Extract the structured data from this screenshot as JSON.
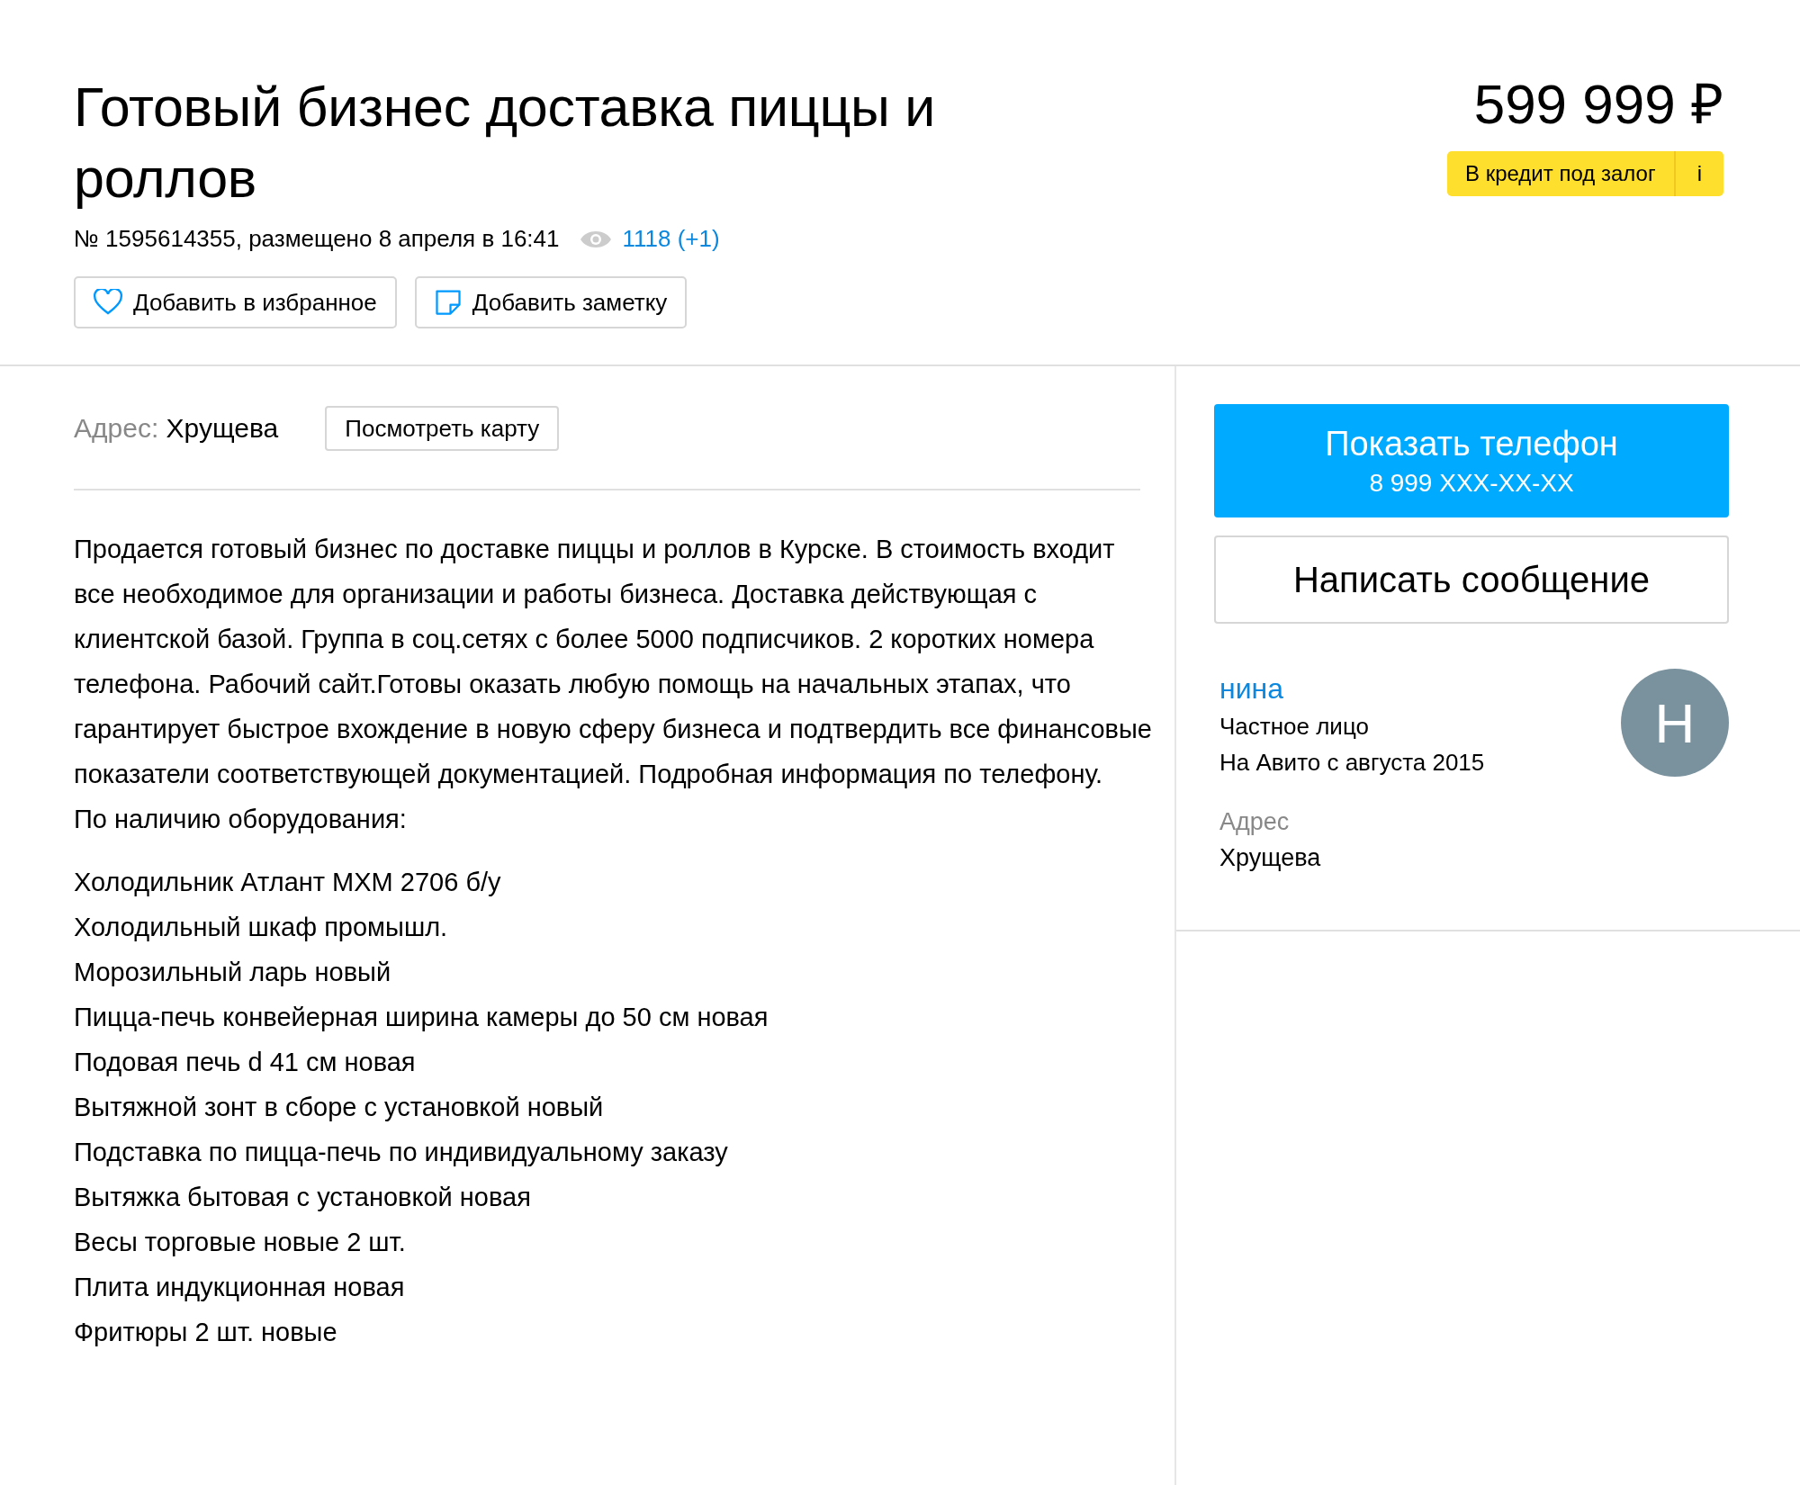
{
  "listing": {
    "title": "Готовый бизнес доставка пиццы и роллов",
    "number_and_date": "№ 1595614355, размещено 8 апреля в 16:41",
    "views": "1118 (+1)",
    "actions": [
      {
        "kind": "favorite",
        "label": "Добавить в избранное"
      },
      {
        "kind": "note",
        "label": "Добавить заметку"
      }
    ]
  },
  "price": {
    "value": "599 999 ₽",
    "credit_badge": "В кредит под залог",
    "info_button": "i"
  },
  "address": {
    "label": "Адрес:",
    "value": "Хрущева",
    "map_button": "Посмотреть карту"
  },
  "description": {
    "paragraphs": [
      "Продается готовый бизнес по доставке пиццы и роллов в Курске. В стоимость входит все необходимое для организации и работы бизнеса. Доставка действующая с клиентской базой. Группа в соц.сетях с более 5000 подписчиков. 2 коротких номера телефона. Рабочий сайт.Готовы оказать любую помощь на начальных этапах, что гарантирует быстрое вхождение в новую сферу бизнеса и подтвердить все финансовые показатели соответствующей документацией. Подробная информация по телефону.",
      "По наличию оборудования:"
    ],
    "equipment": [
      "Холодильник Атлант МХМ 2706 б/у",
      "Холодильный шкаф промышл.",
      "Морозильный ларь новый",
      "Пицца-печь конвейерная ширина камеры до 50 см новая",
      "Подовая печь d 41 см новая",
      "Вытяжной зонт в сборе с установкой новый",
      "Подставка по пицца-печь по индивидуальному заказу",
      "Вытяжка бытовая с установкой новая",
      "Весы торговые новые 2 шт.",
      "Плита индукционная новая",
      "Фритюры 2 шт. новые"
    ]
  },
  "sidebar": {
    "phone_button": {
      "label": "Показать телефон",
      "number": "8 999 XXX-XX-XX"
    },
    "message_button": "Написать сообщение",
    "seller": {
      "name": "нина",
      "type": "Частное лицо",
      "since": "На Авито с августа 2015",
      "avatar_letter": "Н"
    },
    "address_label": "Адрес",
    "address_value": "Хрущева"
  }
}
